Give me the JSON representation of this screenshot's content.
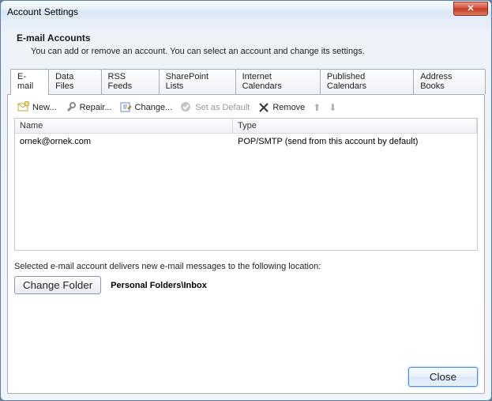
{
  "window": {
    "title": "Account Settings"
  },
  "header": {
    "title": "E-mail Accounts",
    "subtitle": "You can add or remove an account. You can select an account and change its settings."
  },
  "tabs": [
    {
      "label": "E-mail",
      "active": true
    },
    {
      "label": "Data Files"
    },
    {
      "label": "RSS Feeds"
    },
    {
      "label": "SharePoint Lists"
    },
    {
      "label": "Internet Calendars"
    },
    {
      "label": "Published Calendars"
    },
    {
      "label": "Address Books"
    }
  ],
  "toolbar": {
    "new": "New...",
    "repair": "Repair...",
    "change": "Change...",
    "set_default": "Set as Default",
    "remove": "Remove"
  },
  "grid": {
    "col_name": "Name",
    "col_type": "Type",
    "rows": [
      {
        "name": "ornek@ornek.com",
        "type": "POP/SMTP (send from this account by default)"
      }
    ]
  },
  "location_text": "Selected e-mail account delivers new e-mail messages to the following location:",
  "change_folder_btn": "Change Folder",
  "folder_path": "Personal Folders\\Inbox",
  "close_btn": "Close"
}
